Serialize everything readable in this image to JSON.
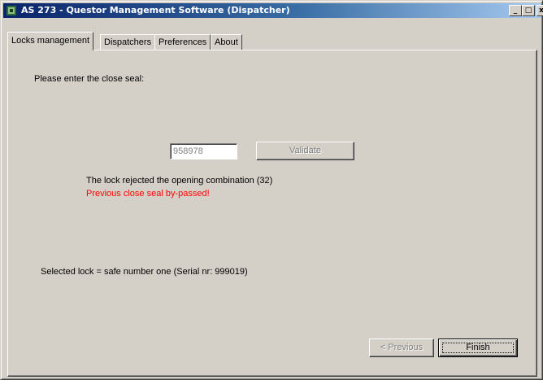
{
  "window": {
    "title": "AS 273 - Questor Management Software (Dispatcher)",
    "controls": {
      "minimize": "_",
      "maximize": "□",
      "close": "x"
    }
  },
  "tabs": [
    {
      "label": "Locks management",
      "active": true
    },
    {
      "label": "Dispatchers",
      "active": false
    },
    {
      "label": "Preferences",
      "active": false
    },
    {
      "label": "About",
      "active": false
    }
  ],
  "main": {
    "prompt": "Please enter the close seal:",
    "seal_input": {
      "value": "958978",
      "enabled": false
    },
    "validate_label": "Validate",
    "status_message": "The lock rejected the opening combination (32)",
    "warning_message": "Previous close seal by-passed!",
    "selected_lock": "Selected lock = safe number one (Serial nr: 999019)"
  },
  "footer": {
    "previous_label": "< Previous",
    "finish_label": "Finish"
  },
  "colors": {
    "face": "#d4d0c8",
    "title_start": "#0a246a",
    "title_end": "#a6caf0",
    "warning": "#ff0000",
    "disabled_text": "#808080"
  }
}
